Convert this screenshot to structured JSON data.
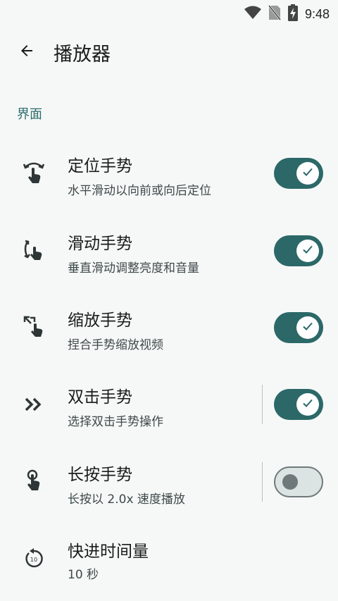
{
  "status": {
    "time": "9:48"
  },
  "header": {
    "title": "播放器"
  },
  "section": {
    "title": "界面"
  },
  "settings": [
    {
      "title": "定位手势",
      "summary": "水平滑动以向前或向后定位",
      "icon": "seek-gesture-icon",
      "toggle": "on"
    },
    {
      "title": "滑动手势",
      "summary": "垂直滑动调整亮度和音量",
      "icon": "swipe-gesture-icon",
      "toggle": "on"
    },
    {
      "title": "缩放手势",
      "summary": "捏合手势缩放视频",
      "icon": "zoom-gesture-icon",
      "toggle": "on"
    },
    {
      "title": "双击手势",
      "summary": "选择双击手势操作",
      "icon": "double-tap-icon",
      "toggle": "on"
    },
    {
      "title": "长按手势",
      "summary": "长按以 2.0x 速度播放",
      "icon": "long-press-icon",
      "toggle": "off"
    },
    {
      "title": "快进时间量",
      "summary": "10 秒",
      "icon": "fast-forward-10-icon",
      "icon_label": "10"
    }
  ],
  "colors": {
    "accent": "#2c6868",
    "background": "#f6f8f8",
    "section_header": "#2e6b6b"
  }
}
